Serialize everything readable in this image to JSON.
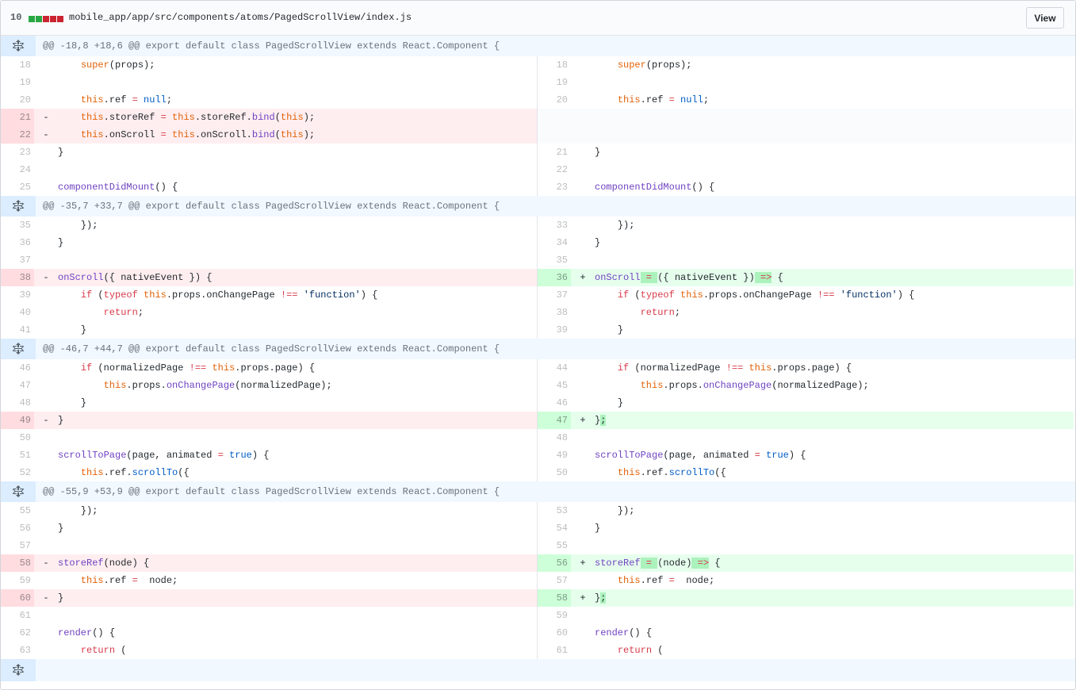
{
  "file": {
    "change_count": "10",
    "path": "mobile_app/app/src/components/atoms/PagedScrollView/index.js",
    "view_button": "View",
    "diffstat": [
      "#28a745",
      "#28a745",
      "#cb2431",
      "#cb2431",
      "#cb2431"
    ]
  },
  "hunks": {
    "h1": "@@ -18,8 +18,6 @@ export default class PagedScrollView extends React.Component {",
    "h2": "@@ -35,7 +33,7 @@ export default class PagedScrollView extends React.Component {",
    "h3": "@@ -46,7 +44,7 @@ export default class PagedScrollView extends React.Component {",
    "h4": "@@ -55,9 +53,9 @@ export default class PagedScrollView extends React.Component {"
  },
  "icons": {
    "expander": "unfold-icon"
  },
  "markers": {
    "del": "-",
    "add": "+"
  },
  "lines": {
    "l18": "18",
    "l19": "19",
    "l20": "20",
    "l21": "21",
    "l22": "22",
    "l23": "23",
    "l24": "24",
    "l25": "25",
    "r18": "18",
    "r19": "19",
    "r20": "20",
    "r21": "21",
    "r22": "22",
    "r23": "23",
    "l35": "35",
    "l36": "36",
    "l37": "37",
    "l38": "38",
    "l39": "39",
    "l40": "40",
    "l41": "41",
    "r33": "33",
    "r34": "34",
    "r35": "35",
    "r36": "36",
    "r37": "37",
    "r38": "38",
    "r39": "39",
    "l46": "46",
    "l47": "47",
    "l48": "48",
    "l49": "49",
    "l50": "50",
    "l51": "51",
    "l52": "52",
    "r44": "44",
    "r45": "45",
    "r46": "46",
    "r47": "47",
    "r48": "48",
    "r49": "49",
    "r50": "50",
    "l55": "55",
    "l56": "56",
    "l57": "57",
    "l58": "58",
    "l59": "59",
    "l60": "60",
    "l61": "61",
    "l62": "62",
    "l63": "63",
    "r53": "53",
    "r54": "54",
    "r55": "55",
    "r56": "56",
    "r57": "57",
    "r58": "58",
    "r59": "59",
    "r60": "60",
    "r61": "61"
  },
  "code": {
    "super_kw": "super",
    "super_rest": "(props);",
    "this": "this",
    "dot_ref_eq": ".ref",
    "eq": " = ",
    "null": "null",
    "semi": ";",
    "store_ref_prop": ".storeRef",
    "store_ref_rhs": ".storeRef.",
    "bind": "bind",
    "bind_arg_open": "(",
    "bind_arg_close": ");",
    "on_scroll_prop": ".onScroll",
    "on_scroll_rhs": ".onScroll.",
    "close_brace": "}",
    "close_brace_semi": ";",
    "cdm_name": "componentDidMount",
    "cdm_rest": "() {",
    "close_paren_brace": "});",
    "on_scroll_name": "onScroll",
    "on_scroll_old_rest": "({ nativeEvent }) {",
    "assign_hl": " = ",
    "on_scroll_new_args": "({ nativeEvent })",
    "arrow_hl": " =>",
    "open_brace": " {",
    "if_kw": "if",
    "if_open": " (",
    "typeof_kw": "typeof",
    "props_on_change_page": ".props.onChangePage",
    "neq": " !== ",
    "function_str": "'function'",
    "if_close": ") {",
    "return_kw": "return",
    "normalized_page": "(normalizedPage",
    "props_page": ".props.page) {",
    "props_dot": ".props.",
    "on_change_page_call": "onChangePage",
    "on_change_page_args": "(normalizedPage);",
    "scroll_to_page_name": "scrollToPage",
    "scroll_to_page_args_a": "(page, animated",
    "true": "true",
    "scroll_to_page_args_b": ") {",
    "ref_dot": ".ref.",
    "scroll_to": "scrollTo",
    "scroll_to_open": "({",
    "store_ref_name": "storeRef",
    "store_ref_old_rest": "(node) {",
    "store_ref_new_args": "(node)",
    "ref_assign": ".ref",
    "node_semi": " node;",
    "render_name": "render",
    "render_rest": "() {",
    "return_open": " ("
  }
}
